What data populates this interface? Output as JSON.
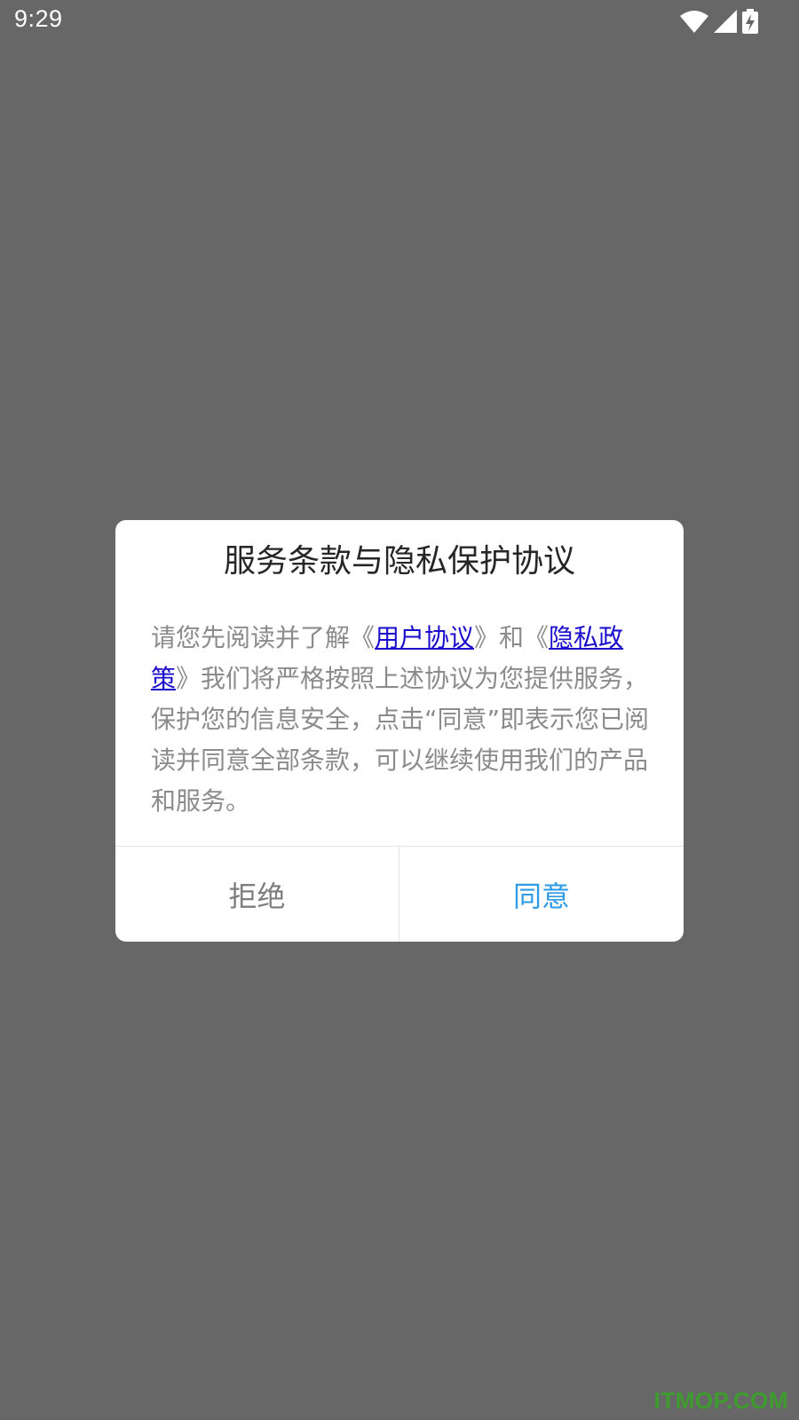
{
  "status_bar": {
    "time": "9:29",
    "icons": [
      "wifi-icon",
      "signal-icon",
      "battery-charging-icon"
    ]
  },
  "dialog": {
    "title": "服务条款与隐私保护协议",
    "body": {
      "prefix": "请您先阅读并了解《",
      "link_user_agreement": "用户协议",
      "middle": "》和《",
      "link_privacy_policy": "隐私政策",
      "suffix": "》我们将严格按照上述协议为您提供服务，保护您的信息安全，点击“同意”即表示您已阅读并同意全部条款，可以继续使用我们的产品和服务。"
    },
    "buttons": {
      "reject": "拒绝",
      "agree": "同意"
    }
  },
  "watermark": "ITMOP.COM",
  "colors": {
    "overlay": "#676767",
    "link": "#1a0dcc",
    "agree": "#2f9ae6",
    "reject": "#7d7d7d",
    "watermark": "#3e9c2e"
  }
}
